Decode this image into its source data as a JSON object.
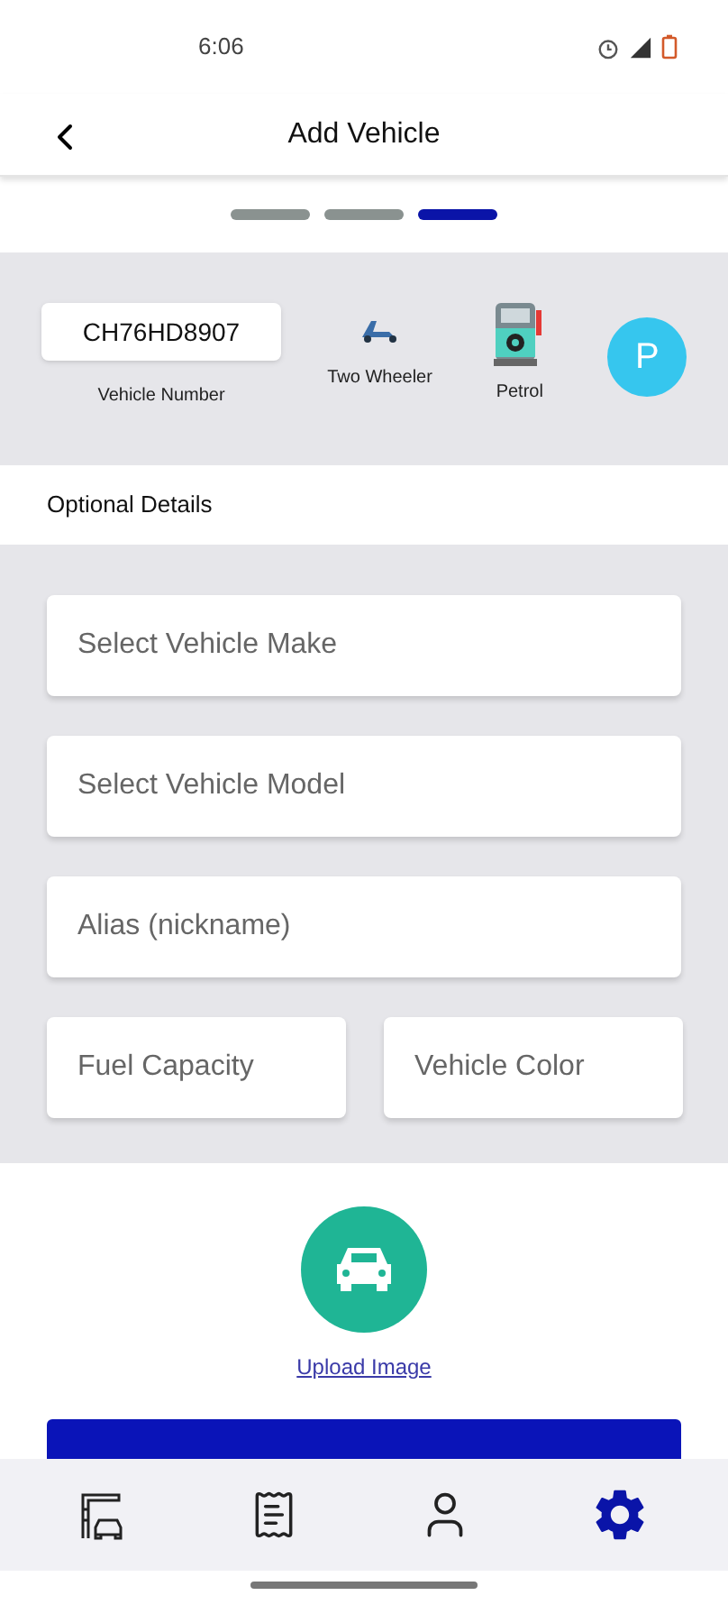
{
  "status_bar": {
    "time": "6:06"
  },
  "header": {
    "title": "Add Vehicle"
  },
  "steps": [
    {
      "selected": false
    },
    {
      "selected": false
    },
    {
      "selected": true
    }
  ],
  "summary": {
    "vehicle_number": "CH76HD8907",
    "vehicle_number_label": "Vehicle Number",
    "type_label": "Two Wheeler",
    "fuel_label": "Petrol",
    "avatar_letter": "P"
  },
  "section_title": "Optional Details",
  "fields": [
    {
      "placeholder": "Select Vehicle Make"
    },
    {
      "placeholder": "Select Vehicle Model"
    },
    {
      "placeholder": "Alias (nickname)"
    }
  ],
  "half_fields": [
    {
      "placeholder": "Fuel Capacity"
    },
    {
      "placeholder": "Vehicle Color"
    }
  ],
  "upload": {
    "label": "Upload Image"
  },
  "bottom_nav": [
    {
      "kind": "station",
      "selected": false
    },
    {
      "kind": "receipt",
      "selected": false
    },
    {
      "kind": "profile",
      "selected": false
    },
    {
      "kind": "settings",
      "selected": true
    }
  ]
}
